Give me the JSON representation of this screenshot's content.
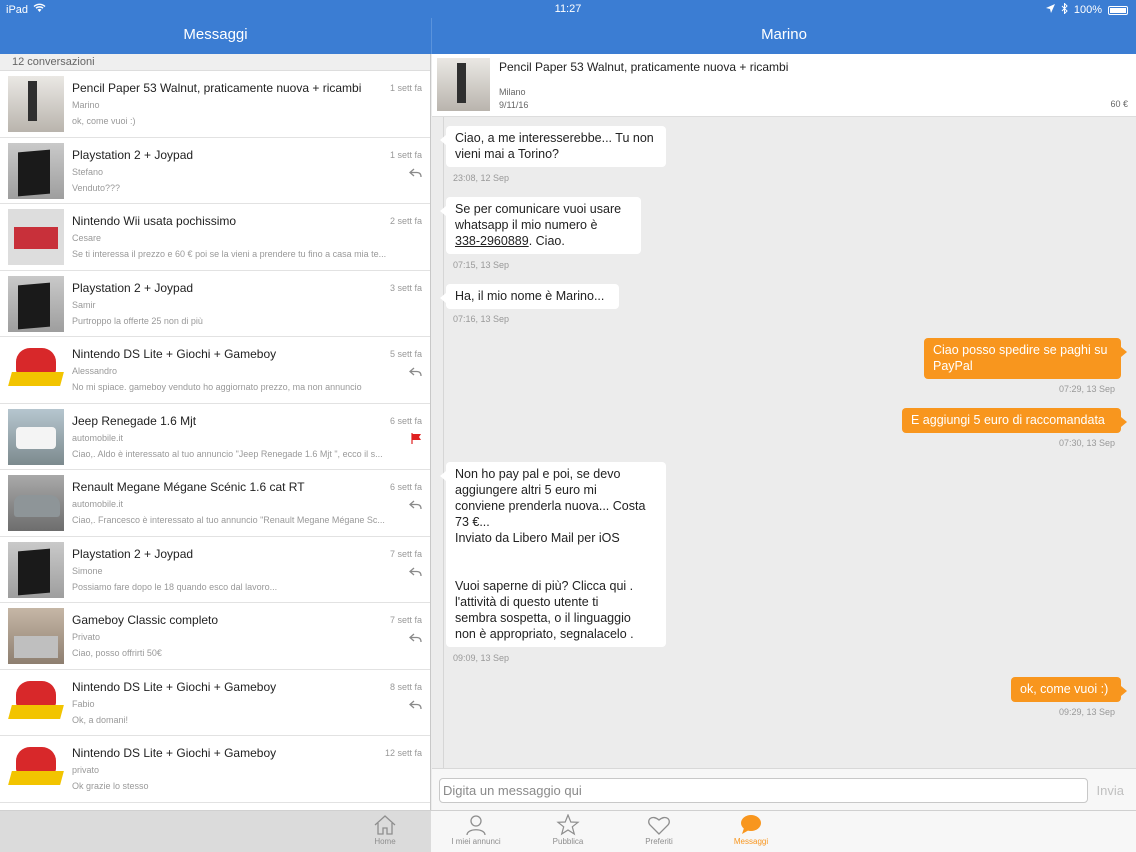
{
  "status_bar": {
    "device": "iPad",
    "time": "11:27",
    "battery": "100%"
  },
  "nav": {
    "left_title": "Messaggi",
    "right_title": "Marino"
  },
  "conversations_header": "12 conversazioni",
  "conversations": [
    {
      "title": "Pencil Paper 53 Walnut, praticamente nuova + ricambi",
      "time": "1 sett fa",
      "user": "Marino",
      "preview": "ok, come vuoi :)",
      "status_icon": "",
      "thumb": "lamp"
    },
    {
      "title": "Playstation 2 + Joypad",
      "time": "1 sett fa",
      "user": "Stefano",
      "preview": "Venduto???",
      "status_icon": "reply-icon",
      "thumb": "console"
    },
    {
      "title": "Nintendo Wii usata pochissimo",
      "time": "2 sett fa",
      "user": "Cesare",
      "preview": "Se ti interessa il prezzo e 60 € poi se la vieni a prendere tu fino a casa mia te...",
      "status_icon": "",
      "thumb": "wii"
    },
    {
      "title": "Playstation 2 + Joypad",
      "time": "3 sett fa",
      "user": "Samir",
      "preview": "Purtroppo la offerte 25 non di più",
      "status_icon": "",
      "thumb": "console"
    },
    {
      "title": "Nintendo DS Lite + Giochi + Gameboy",
      "time": "5 sett fa",
      "user": "Alessandro",
      "preview": "No mi spiace. gameboy venduto ho aggiornato prezzo, ma non annuncio",
      "status_icon": "reply-icon",
      "thumb": "mario"
    },
    {
      "title": "Jeep Renegade 1.6 Mjt",
      "time": "6 sett fa",
      "user": "automobile.it",
      "preview": "Ciao,. Aldo è interessato al tuo annuncio \"Jeep Renegade 1.6 Mjt \", ecco il s...",
      "status_icon": "flag-icon",
      "thumb": "jeep"
    },
    {
      "title": "Renault Megane Mégane Scénic 1.6 cat RT",
      "time": "6 sett fa",
      "user": "automobile.it",
      "preview": "Ciao,. Francesco è interessato al tuo annuncio \"Renault Megane Mégane Sc...",
      "status_icon": "reply-icon",
      "thumb": "car"
    },
    {
      "title": "Playstation 2 + Joypad",
      "time": "7 sett fa",
      "user": "Simone",
      "preview": "Possiamo fare dopo le 18 quando esco dal lavoro...",
      "status_icon": "reply-icon",
      "thumb": "console"
    },
    {
      "title": "Gameboy Classic completo",
      "time": "7 sett fa",
      "user": "Privato",
      "preview": "Ciao, posso offrirti 50€",
      "status_icon": "reply-icon",
      "thumb": "gameboy"
    },
    {
      "title": "Nintendo DS Lite + Giochi + Gameboy",
      "time": "8 sett fa",
      "user": "Fabio",
      "preview": "Ok, a domani!",
      "status_icon": "reply-icon",
      "thumb": "mario"
    },
    {
      "title": "Nintendo DS Lite + Giochi + Gameboy",
      "time": "12 sett fa",
      "user": "privato",
      "preview": "Ok grazie lo stesso",
      "status_icon": "",
      "thumb": "mario"
    }
  ],
  "listing": {
    "title": "Pencil Paper 53 Walnut, praticamente nuova + ricambi",
    "location": "Milano",
    "date": "9/11/16",
    "price": "60 €"
  },
  "messages": [
    {
      "dir": "in",
      "text": "Ciao, a me interesserebbe... Tu non\nvieni mai a Torino?",
      "time": "23:08, 12 Sep"
    },
    {
      "dir": "in",
      "text_before": "Se per comunicare vuoi usare\nwhatsapp il mio numero è\n",
      "phone": "338-2960889",
      "text_after": ". Ciao.",
      "time": "07:15, 13 Sep"
    },
    {
      "dir": "in",
      "text": "Ha, il mio nome è Marino...",
      "time": "07:16, 13 Sep"
    },
    {
      "dir": "out",
      "text": "Ciao posso spedire se paghi su\nPayPal",
      "time": "07:29, 13 Sep"
    },
    {
      "dir": "out",
      "text": "E aggiungi 5 euro di raccomandata",
      "time": "07:30, 13 Sep"
    },
    {
      "dir": "in",
      "text": "Non ho pay pal e poi, se devo\naggiungere altri 5 euro mi\nconviene prenderla nuova... Costa\n73 €...\nInviato da Libero Mail per iOS\n\n\nVuoi saperne di più? Clicca qui .\nl'attività di questo utente ti\nsembra sospetta, o il linguaggio\nnon è appropriato, segnalacelo .",
      "time": "09:09, 13 Sep"
    },
    {
      "dir": "out",
      "text": "ok, come vuoi :)",
      "time": "09:29, 13 Sep"
    }
  ],
  "composer": {
    "placeholder": "Digita un messaggio qui",
    "send_label": "Invia"
  },
  "tabs": [
    {
      "label": "Home",
      "icon": "home-icon"
    },
    {
      "label": "I miei annunci",
      "icon": "person-icon"
    },
    {
      "label": "Pubblica",
      "icon": "star-icon"
    },
    {
      "label": "Preferiti",
      "icon": "heart-icon"
    },
    {
      "label": "Messaggi",
      "icon": "chat-icon",
      "active": true
    }
  ],
  "colors": {
    "nav_blue": "#3b7dd3",
    "accent_orange": "#f8961e",
    "flag_red": "#e02020"
  }
}
